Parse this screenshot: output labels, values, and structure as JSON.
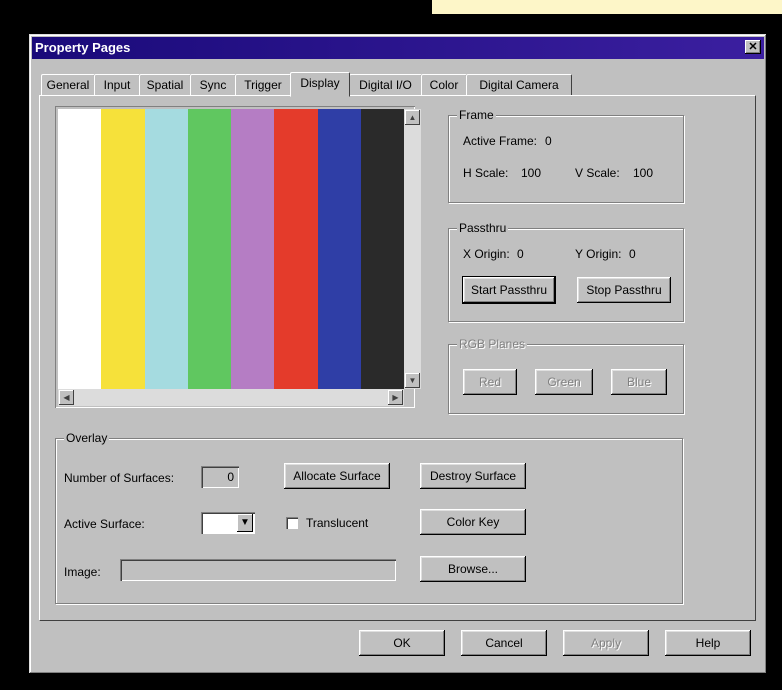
{
  "window": {
    "title": "Property Pages",
    "close_icon": "close-icon"
  },
  "tabs": [
    "General",
    "Input",
    "Spatial",
    "Sync",
    "Trigger",
    "Display",
    "Digital I/O",
    "Color",
    "Digital Camera"
  ],
  "active_tab": "Display",
  "preview": {
    "bar_colors": [
      "#ffffff",
      "#f6e13a",
      "#a5dbe0",
      "#60c760",
      "#b57dc4",
      "#e43b2b",
      "#2f3ea6",
      "#2a2a2a"
    ],
    "scroll_up_icon": "scroll-up-icon",
    "scroll_down_icon": "scroll-down-icon",
    "scroll_left_icon": "scroll-left-icon",
    "scroll_right_icon": "scroll-right-icon"
  },
  "frame": {
    "label": "Frame",
    "active_frame_label": "Active Frame:",
    "active_frame_value": "0",
    "h_scale_label": "H Scale:",
    "h_scale_value": "100",
    "v_scale_label": "V Scale:",
    "v_scale_value": "100"
  },
  "passthru": {
    "label": "Passthru",
    "x_origin_label": "X Origin:",
    "x_origin_value": "0",
    "y_origin_label": "Y Origin:",
    "y_origin_value": "0",
    "start_label": "Start Passthru",
    "stop_label": "Stop Passthru"
  },
  "rgb_planes": {
    "label": "RGB Planes",
    "red": "Red",
    "green": "Green",
    "blue": "Blue"
  },
  "overlay": {
    "label": "Overlay",
    "surfaces_label": "Number of Surfaces:",
    "surfaces_value": "0",
    "allocate_label": "Allocate Surface",
    "destroy_label": "Destroy Surface",
    "active_surface_label": "Active Surface:",
    "translucent_label": "Translucent",
    "color_key_label": "Color Key",
    "image_label": "Image:",
    "image_value": "",
    "browse_label": "Browse..."
  },
  "footer": {
    "ok": "OK",
    "cancel": "Cancel",
    "apply": "Apply",
    "help": "Help"
  }
}
